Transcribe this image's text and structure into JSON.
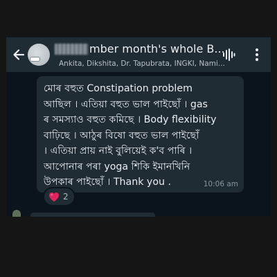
{
  "header": {
    "title": "mber month's whole B...",
    "participants": "Ankita, Dikshita, Dr. Tapubrata, INGKI, Nami...",
    "back_icon": "arrow-left-icon",
    "voice_icon": "voice-waveform-icon",
    "menu_icon": "more-vertical-icon"
  },
  "message": {
    "lines": [
      "মোৰ  বহুত Constipation problem",
      "আছিল । এতিয়া বহুত ভাল পাইছোঁ । gas",
      "ৰ সমস্যাও বহুত কমিছে । Body flexibility",
      "বাঢ়িছে । আঠুৰ বিষো বহুত ভাল পাইছোঁ",
      "। এতিয়া প্ৰায় নাই বুলিয়েই ক'ব পাৰি ।",
      "আপোনাৰ পৰা yoga শিকি ইমানখিনি",
      "উপকাৰ পাইছোঁ । Thank you ."
    ],
    "time": "10:06 am"
  },
  "reaction": {
    "emoji": "heart-icon",
    "count": "2"
  },
  "colors": {
    "header_bg": "#1f2c34",
    "chat_bg": "#0b141a",
    "bubble_bg": "#1f2c34",
    "text": "#e9edef",
    "meta": "#8696a0",
    "heart": "#e0245e"
  }
}
